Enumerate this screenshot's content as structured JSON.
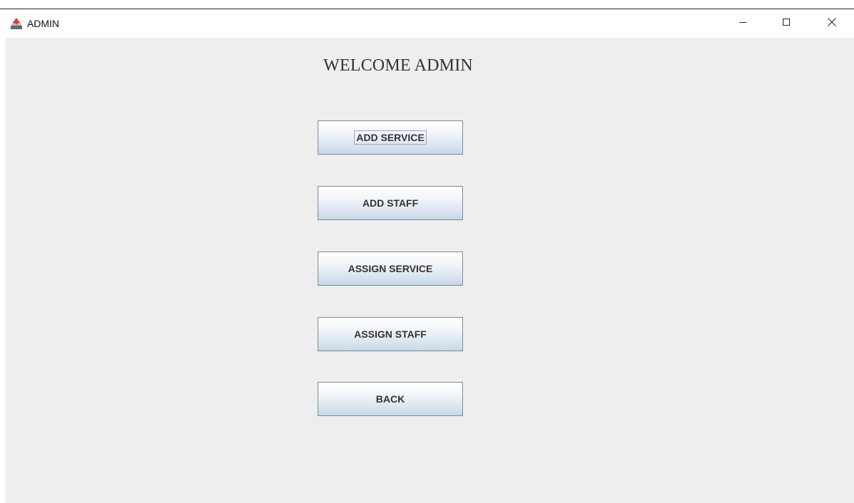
{
  "window": {
    "title": "ADMIN",
    "icon": "java-app-icon",
    "controls": {
      "minimize_icon": "minimize-icon",
      "maximize_icon": "maximize-icon",
      "close_icon": "close-icon"
    }
  },
  "main": {
    "heading": "WELCOME ADMIN",
    "buttons": [
      {
        "label": "ADD SERVICE",
        "focused": true
      },
      {
        "label": "ADD STAFF",
        "focused": false
      },
      {
        "label": "ASSIGN SERVICE",
        "focused": false
      },
      {
        "label": "ASSIGN STAFF",
        "focused": false
      },
      {
        "label": "BACK",
        "focused": false
      }
    ]
  },
  "colors": {
    "content_background": "#eeeeee",
    "button_border": "#7a8a99",
    "text": "#333333"
  }
}
